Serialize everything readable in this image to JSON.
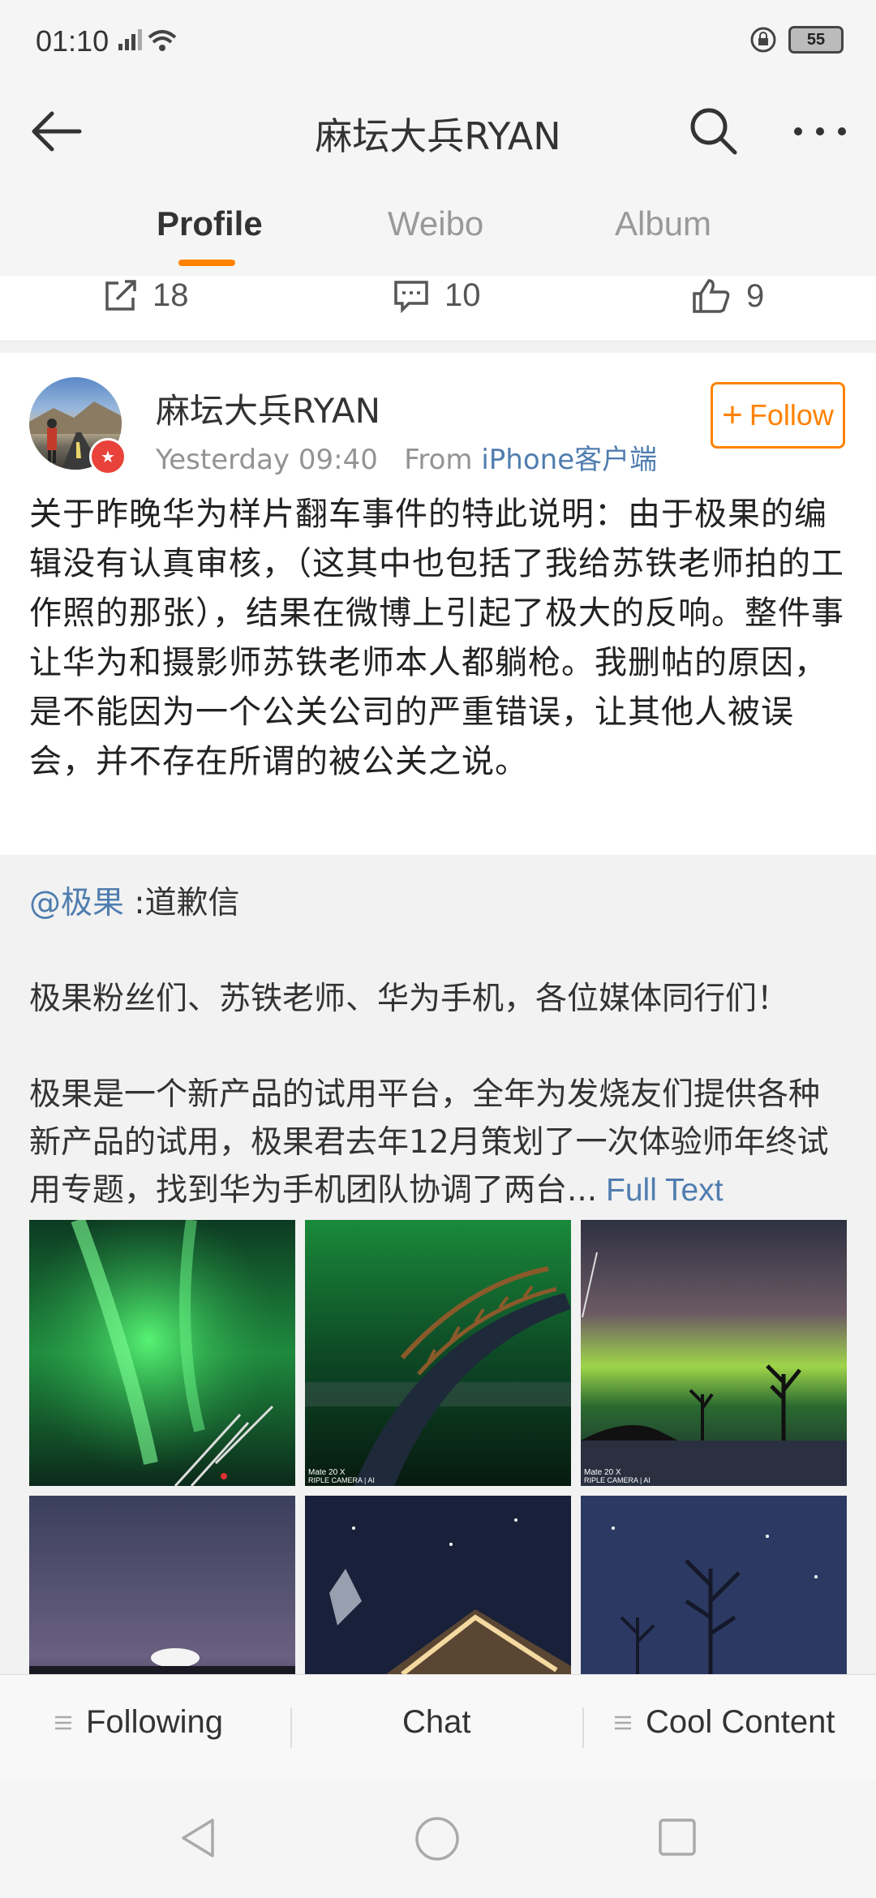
{
  "status": {
    "time": "01:10",
    "battery": "55"
  },
  "nav": {
    "title": "麻坛大兵RYAN"
  },
  "tabs": [
    {
      "label": "Profile",
      "active": true
    },
    {
      "label": "Weibo",
      "active": false
    },
    {
      "label": "Album",
      "active": false
    }
  ],
  "actions": {
    "reposts": "18",
    "comments": "10",
    "likes": "9"
  },
  "post": {
    "author": "麻坛大兵RYAN",
    "time": "Yesterday 09:40",
    "from_label": "From",
    "source": "iPhone客户端",
    "follow_label": "Follow",
    "text": "关于昨晚华为样片翻车事件的特此说明：由于极果的编辑没有认真审核，（这其中也包括了我给苏铁老师拍的工作照的那张），结果在微博上引起了极大的反响。整件事让华为和摄影师苏铁老师本人都躺枪。我删帖的原因，是不能因为一个公关公司的严重错误，让其他人被误会，并不存在所谓的被公关之说。"
  },
  "repost": {
    "mention": "@极果",
    "mention_suffix": " :道歉信",
    "para1": "极果粉丝们、苏铁老师、华为手机，各位媒体同行们！",
    "para2": "极果是一个新产品的试用平台，全年为发烧友们提供各种新产品的试用，极果君去年12月策划了一次体验师年终试用专题，找到华为手机团队协调了两台...",
    "full_text_label": " Full Text",
    "watermarks": [
      "Mate 20 X\nRIPLE CAMERA | AI",
      "Mate 20 X\nRIPLE CAMERA | AI"
    ]
  },
  "bottom_tabs": [
    {
      "label": "Following"
    },
    {
      "label": "Chat"
    },
    {
      "label": "Cool Content"
    }
  ],
  "colors": {
    "accent": "#ff8200",
    "link": "#507daf"
  }
}
